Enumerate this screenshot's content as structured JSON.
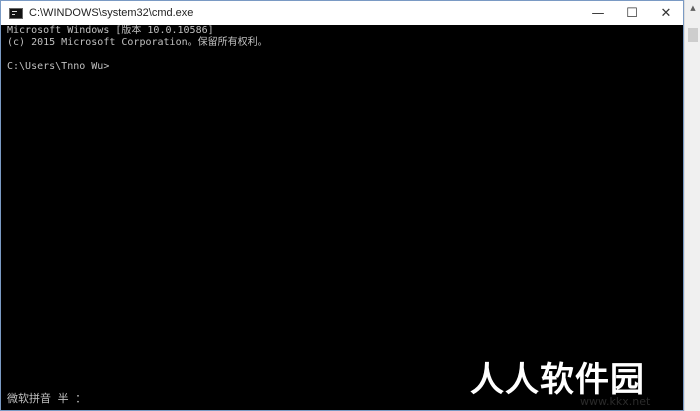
{
  "window": {
    "title": "C:\\WINDOWS\\system32\\cmd.exe",
    "controls": {
      "minimize": "—",
      "maximize": "☐",
      "close": "✕"
    }
  },
  "console": {
    "lines": [
      "Microsoft Windows [版本 10.0.10586]",
      "(c) 2015 Microsoft Corporation。保留所有权利。",
      "",
      "C:\\Users\\Tnno Wu>"
    ]
  },
  "ime": {
    "status": "微软拼音 半 ："
  },
  "scrollbar": {
    "up_arrow": "▲",
    "down_arrow": "▼"
  },
  "watermark": {
    "text": "人人软件园",
    "url": "www.kkx.net"
  }
}
